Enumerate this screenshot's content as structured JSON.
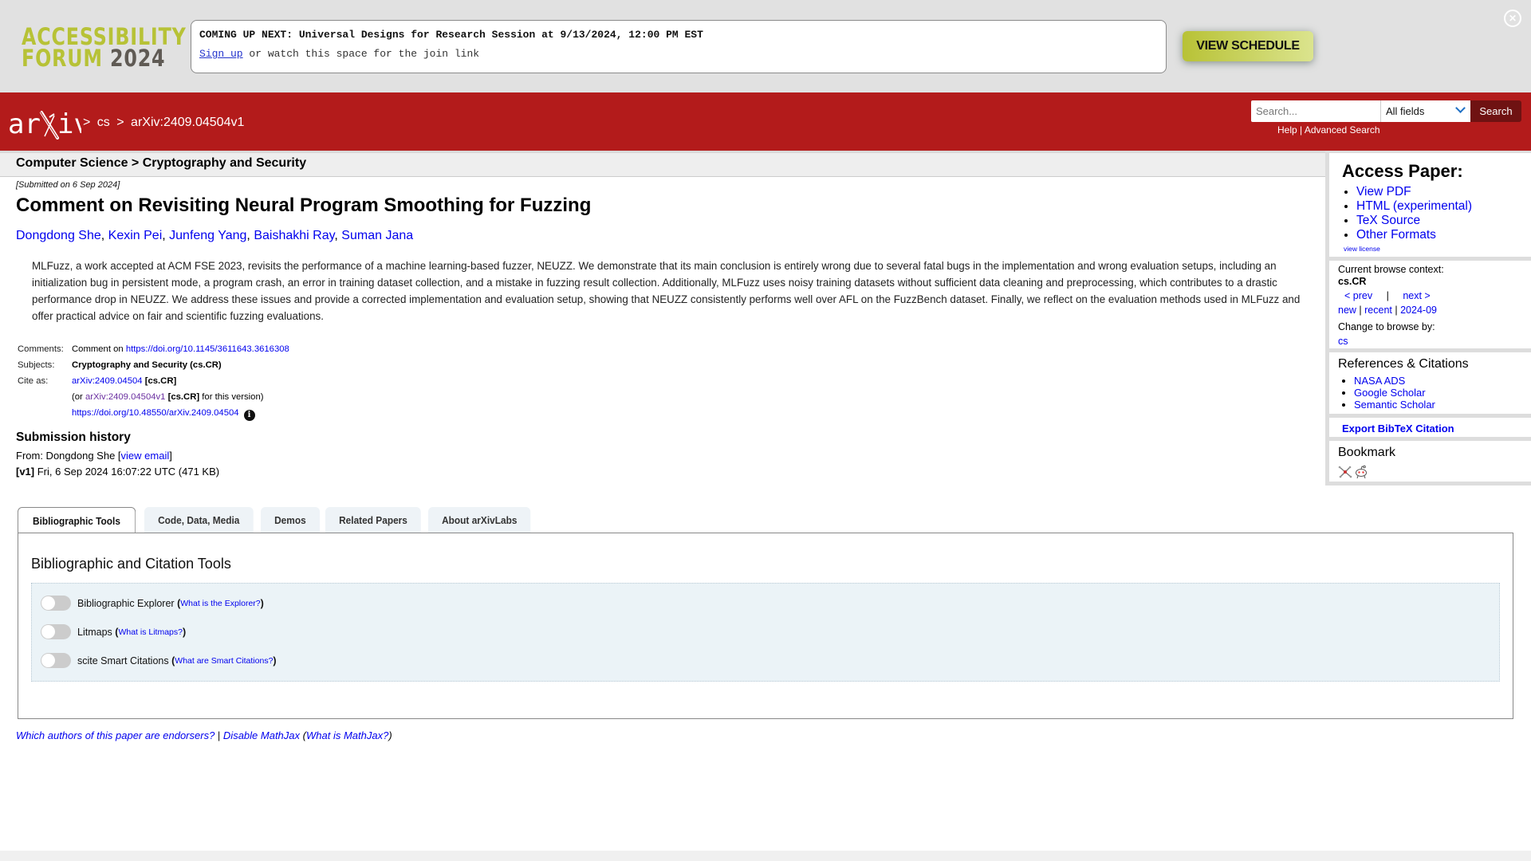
{
  "banner": {
    "logo_line1": "ACCESSIBILITY",
    "logo_line2": "FORUM",
    "logo_year": "2024",
    "announcement_bold": "COMING UP NEXT: Universal Designs for Research Session at 9/13/2024, 12:00 PM EST",
    "signup_link": "Sign up",
    "announcement_rest": " or watch this space for the join link",
    "view_schedule": "VIEW SCHEDULE",
    "close_icon": "close-circle-icon"
  },
  "header": {
    "logo_text": "arXiv",
    "crumbs": [
      ">",
      "cs",
      ">",
      "arXiv:2409.04504v1"
    ],
    "search_placeholder": "Search...",
    "search_field": "All fields",
    "search_button": "Search",
    "help": "Help",
    "help_sep": " | ",
    "advanced_search": "Advanced Search",
    "accent_color": "#b31b1b"
  },
  "subheader": {
    "text": "Computer Science > Cryptography and Security"
  },
  "paper": {
    "submitted": "[Submitted on 6 Sep 2024]",
    "title": "Comment on Revisiting Neural Program Smoothing for Fuzzing",
    "authors": [
      "Dongdong She",
      "Kexin Pei",
      "Junfeng Yang",
      "Baishakhi Ray",
      "Suman Jana"
    ],
    "abstract": "MLFuzz, a work accepted at ACM FSE 2023, revisits the performance of a machine learning-based fuzzer, NEUZZ. We demonstrate that its main conclusion is entirely wrong due to several fatal bugs in the implementation and wrong evaluation setups, including an initialization bug in persistent mode, a program crash, an error in training dataset collection, and a mistake in fuzzing result collection. Additionally, MLFuzz uses noisy training datasets without sufficient data cleaning and preprocessing, which contributes to a drastic performance drop in NEUZZ. We address these issues and provide a corrected implementation and evaluation setup, showing that NEUZZ consistently performs well over AFL on the FuzzBench dataset. Finally, we reflect on the evaluation methods used in MLFuzz and offer practical advice on fair and scientific fuzzing evaluations.",
    "meta": {
      "comments_label": "Comments:",
      "comments_prefix": "Comment on ",
      "comments_link": "https://doi.org/10.1145/3611643.3616308",
      "subjects_label": "Subjects:",
      "subjects": "Cryptography and Security (cs.CR)",
      "cite_label": "Cite as:",
      "cite_id": "arXiv:2409.04504",
      "cite_cat": " [cs.CR]",
      "cite_or": "(or ",
      "cite_version": "arXiv:2409.04504v1",
      "cite_version_cat": " [cs.CR]",
      "cite_version_suffix": " for this version)",
      "doi": "https://doi.org/10.48550/arXiv.2409.04504",
      "info_icon": "i"
    },
    "history": {
      "heading": "Submission history",
      "from_prefix": "From: Dongdong She [",
      "view_email": "view email",
      "from_suffix": "]",
      "version_tag": "[v1]",
      "version_info": " Fri, 6 Sep 2024 16:07:22 UTC (471 KB)"
    }
  },
  "tabs": [
    {
      "label": "Bibliographic Tools",
      "active": true
    },
    {
      "label": "Code, Data, Media",
      "active": false
    },
    {
      "label": "Demos",
      "active": false
    },
    {
      "label": "Related Papers",
      "active": false
    },
    {
      "label": "About arXivLabs",
      "active": false
    }
  ],
  "panel": {
    "title": "Bibliographic and Citation Tools",
    "tools": [
      {
        "label": "Bibliographic Explorer",
        "help": "What is the Explorer?",
        "enabled": false
      },
      {
        "label": "Litmaps",
        "help": "What is Litmaps?",
        "enabled": false
      },
      {
        "label": "scite Smart Citations",
        "help": "What are Smart Citations?",
        "enabled": false
      }
    ]
  },
  "footer": {
    "endorsers": "Which authors of this paper are endorsers?",
    "sep": " | ",
    "disable_mathjax": "Disable MathJax",
    "open_paren": " (",
    "what_mathjax": "What is MathJax?",
    "close_paren": ")"
  },
  "sidebar": {
    "access_title": "Access Paper:",
    "access_links": [
      "View PDF",
      "HTML (experimental)",
      "TeX Source",
      "Other Formats"
    ],
    "view_license": "view license",
    "context_label": "Current browse context:",
    "context_value": "cs.CR",
    "prev": "< prev",
    "nav_sep": "|",
    "next": "next >",
    "new": "new",
    "recent": "recent",
    "month": "2024-09",
    "pipe": " | ",
    "change_label": "Change to browse by:",
    "change_value": "cs",
    "refs_title": "References & Citations",
    "refs_links": [
      "NASA ADS",
      "Google Scholar",
      "Semantic Scholar"
    ],
    "export_bibtex": "Export BibTeX Citation",
    "bookmark_title": "Bookmark",
    "bookmark_icons": [
      "bibsonomy-icon",
      "reddit-icon"
    ]
  }
}
